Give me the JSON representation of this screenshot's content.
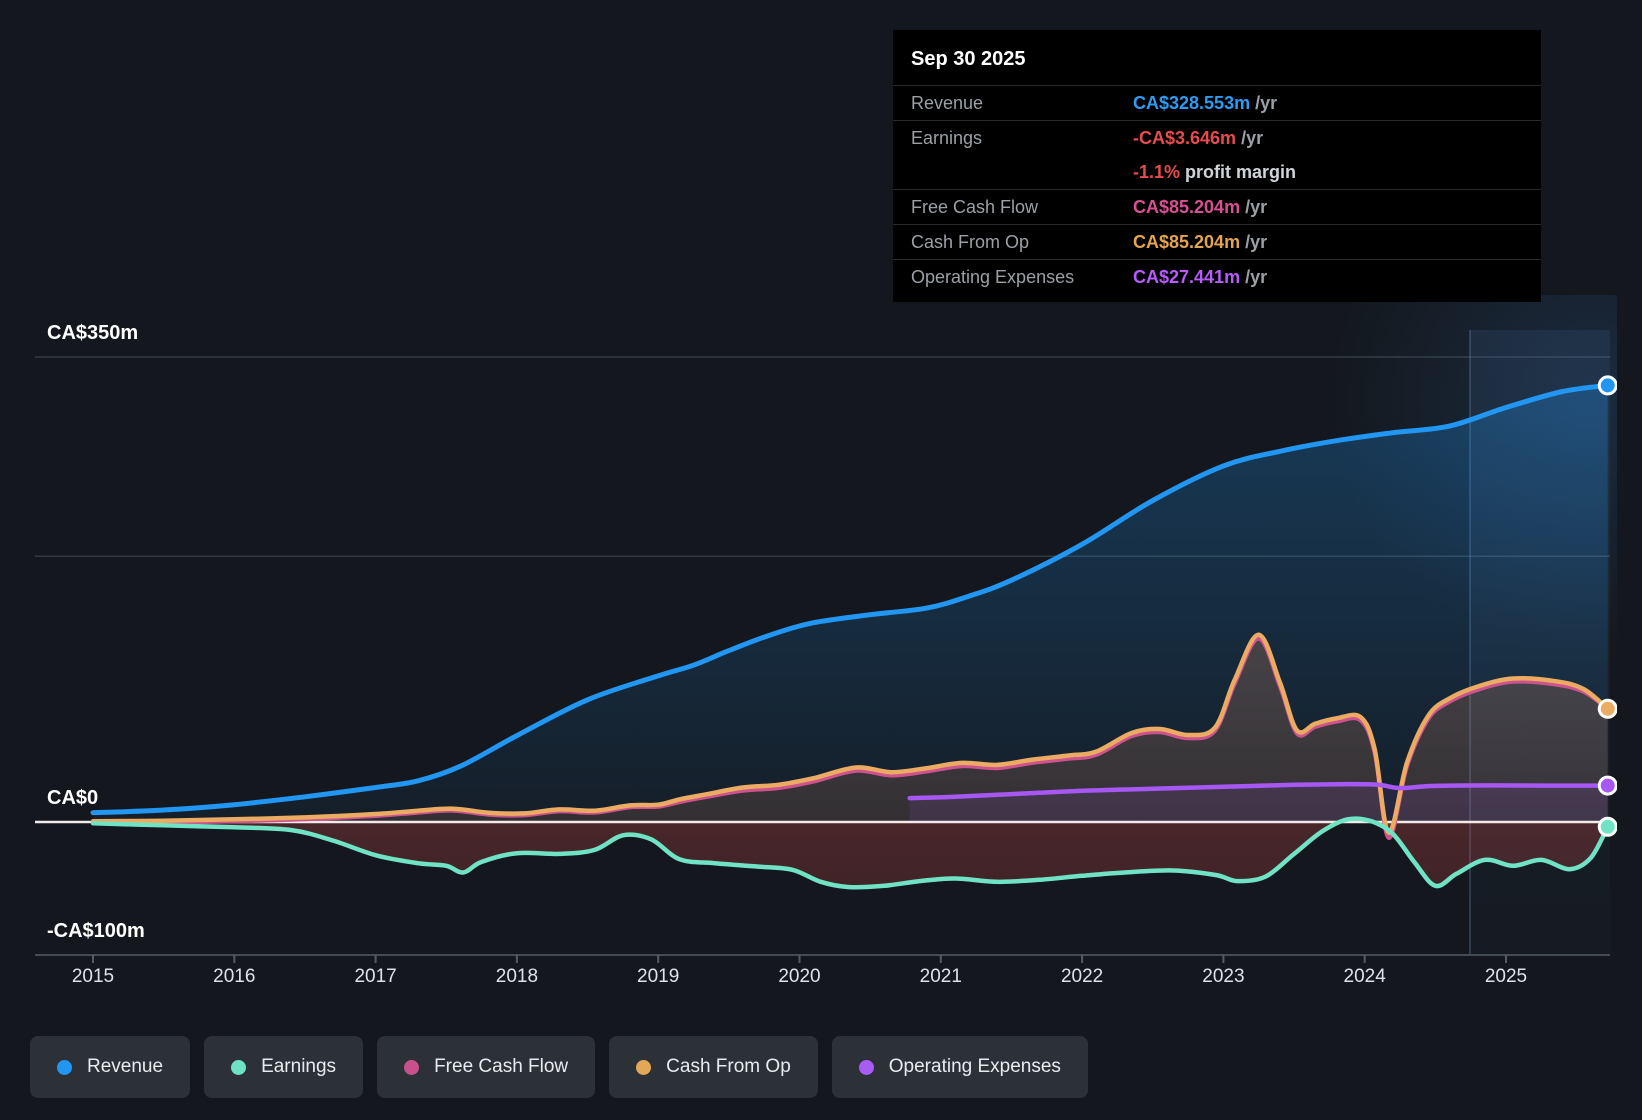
{
  "tooltip": {
    "title": "Sep 30 2025",
    "rows": [
      {
        "label": "Revenue",
        "value": "CA$328.553m",
        "suffix": " /yr",
        "value_color": "#2d9bf3"
      },
      {
        "label": "Earnings",
        "value": "-CA$3.646m",
        "suffix": " /yr",
        "value_color": "#e64c4f"
      },
      {
        "label": "",
        "value": "-1.1%",
        "suffix": " profit margin",
        "value_color": "#e64c4f"
      },
      {
        "label": "Free Cash Flow",
        "value": "CA$85.204m",
        "suffix": " /yr",
        "value_color": "#d94f93"
      },
      {
        "label": "Cash From Op",
        "value": "CA$85.204m",
        "suffix": " /yr",
        "value_color": "#e3a44f"
      },
      {
        "label": "Operating Expenses",
        "value": "CA$27.441m",
        "suffix": " /yr",
        "value_color": "#b75cfa"
      }
    ]
  },
  "legend": {
    "items": [
      {
        "label": "Revenue",
        "color": "#2196f3"
      },
      {
        "label": "Earnings",
        "color": "#6fe3c1"
      },
      {
        "label": "Free Cash Flow",
        "color": "#c9518b"
      },
      {
        "label": "Cash From Op",
        "color": "#e2a757"
      },
      {
        "label": "Operating Expenses",
        "color": "#a95bf5"
      }
    ]
  },
  "chart_data": {
    "type": "area",
    "title": "Financial history: revenue, earnings and cash flow (CA$m)",
    "y_ticks": [
      {
        "label": "CA$350m",
        "value": 350
      },
      {
        "label": "CA$0",
        "value": 0
      },
      {
        "label": "-CA$100m",
        "value": -100
      }
    ],
    "mid_gridline_value": 200,
    "x_ticks": [
      2015,
      2016,
      2017,
      2018,
      2019,
      2020,
      2021,
      2022,
      2023,
      2024,
      2025
    ],
    "xlim": [
      2014.59,
      2025.78
    ],
    "ylim": [
      -100,
      370
    ],
    "grid": true,
    "legend_position": "bottom",
    "highlight_band_start": 2024.745,
    "highlight_band_end": 2025.78,
    "series": [
      {
        "name": "Revenue",
        "color": "#2196f3",
        "width": 5,
        "fill_top": "rgba(33,150,243,0.30)",
        "fill_bottom": "rgba(33,150,243,0.05)",
        "end_marker": true,
        "points": [
          [
            2015,
            7
          ],
          [
            2015.5,
            9
          ],
          [
            2016,
            13
          ],
          [
            2016.5,
            19
          ],
          [
            2017,
            26
          ],
          [
            2017.3,
            31
          ],
          [
            2017.6,
            42
          ],
          [
            2018,
            65
          ],
          [
            2018.5,
            92
          ],
          [
            2019,
            110
          ],
          [
            2019.25,
            118
          ],
          [
            2019.5,
            129
          ],
          [
            2019.8,
            141
          ],
          [
            2020.1,
            150
          ],
          [
            2020.5,
            156
          ],
          [
            2020.9,
            161
          ],
          [
            2021.2,
            170
          ],
          [
            2021.5,
            182
          ],
          [
            2022,
            209
          ],
          [
            2022.5,
            242
          ],
          [
            2023,
            268
          ],
          [
            2023.4,
            279
          ],
          [
            2023.8,
            287
          ],
          [
            2024.2,
            293
          ],
          [
            2024.6,
            298
          ],
          [
            2025,
            312
          ],
          [
            2025.4,
            324
          ],
          [
            2025.72,
            328.6
          ]
        ]
      },
      {
        "name": "Free Cash Flow",
        "color": "#cc538d",
        "width": 4,
        "fill_top": "rgba(204,83,141,0.12)",
        "fill_bottom": "rgba(204,83,141,0.05)",
        "end_marker": false,
        "points": [
          [
            2015,
            -0.8
          ],
          [
            2015.5,
            -0.5
          ],
          [
            2016,
            0.5
          ],
          [
            2016.5,
            2
          ],
          [
            2017,
            4.5
          ],
          [
            2017.3,
            7
          ],
          [
            2017.55,
            8.5
          ],
          [
            2017.8,
            5.5
          ],
          [
            2018.05,
            5
          ],
          [
            2018.3,
            8
          ],
          [
            2018.55,
            7
          ],
          [
            2018.8,
            11
          ],
          [
            2019,
            11.5
          ],
          [
            2019.15,
            15
          ],
          [
            2019.35,
            19
          ],
          [
            2019.6,
            23.5
          ],
          [
            2019.85,
            25.5
          ],
          [
            2020.1,
            30.5
          ],
          [
            2020.4,
            38.5
          ],
          [
            2020.65,
            35
          ],
          [
            2020.9,
            38
          ],
          [
            2021.15,
            42
          ],
          [
            2021.4,
            40.5
          ],
          [
            2021.65,
            44.5
          ],
          [
            2021.9,
            47.5
          ],
          [
            2022.1,
            50.5
          ],
          [
            2022.35,
            64.5
          ],
          [
            2022.55,
            67.5
          ],
          [
            2022.75,
            63
          ],
          [
            2022.94,
            68.5
          ],
          [
            2023.08,
            104
          ],
          [
            2023.25,
            138
          ],
          [
            2023.4,
            102
          ],
          [
            2023.52,
            66.5
          ],
          [
            2023.65,
            71.5
          ],
          [
            2023.8,
            75.5
          ],
          [
            2023.97,
            76.5
          ],
          [
            2024.07,
            52
          ],
          [
            2024.17,
            -12
          ],
          [
            2024.3,
            42
          ],
          [
            2024.45,
            77.5
          ],
          [
            2024.6,
            90.5
          ],
          [
            2024.8,
            99.5
          ],
          [
            2025.05,
            105.5
          ],
          [
            2025.35,
            103.5
          ],
          [
            2025.55,
            98
          ],
          [
            2025.72,
            85.2
          ]
        ]
      },
      {
        "name": "Cash From Op",
        "color": "#ecab62",
        "width": 4.5,
        "fill_top": "rgba(232,168,92,0.30)",
        "fill_bottom": "rgba(232,168,92,0.10)",
        "end_marker": true,
        "points": [
          [
            2015,
            0.5
          ],
          [
            2015.5,
            1
          ],
          [
            2016,
            2
          ],
          [
            2016.5,
            3.5
          ],
          [
            2017,
            6
          ],
          [
            2017.3,
            8.5
          ],
          [
            2017.55,
            10
          ],
          [
            2017.8,
            7
          ],
          [
            2018.05,
            6.5
          ],
          [
            2018.3,
            9.5
          ],
          [
            2018.55,
            8.5
          ],
          [
            2018.8,
            12.5
          ],
          [
            2019,
            13
          ],
          [
            2019.15,
            17
          ],
          [
            2019.35,
            21
          ],
          [
            2019.6,
            26
          ],
          [
            2019.85,
            28
          ],
          [
            2020.1,
            33
          ],
          [
            2020.4,
            41
          ],
          [
            2020.65,
            37.5
          ],
          [
            2020.9,
            40.5
          ],
          [
            2021.15,
            44.5
          ],
          [
            2021.4,
            43
          ],
          [
            2021.65,
            47
          ],
          [
            2021.9,
            50
          ],
          [
            2022.1,
            53
          ],
          [
            2022.35,
            67
          ],
          [
            2022.55,
            70
          ],
          [
            2022.75,
            65.5
          ],
          [
            2022.94,
            71
          ],
          [
            2023.08,
            107
          ],
          [
            2023.25,
            141
          ],
          [
            2023.4,
            105
          ],
          [
            2023.52,
            69
          ],
          [
            2023.65,
            74
          ],
          [
            2023.8,
            78
          ],
          [
            2023.97,
            79
          ],
          [
            2024.07,
            55
          ],
          [
            2024.17,
            -8
          ],
          [
            2024.3,
            45
          ],
          [
            2024.45,
            80
          ],
          [
            2024.6,
            93
          ],
          [
            2024.8,
            102
          ],
          [
            2025.05,
            108
          ],
          [
            2025.35,
            106
          ],
          [
            2025.55,
            100
          ],
          [
            2025.72,
            85.2
          ]
        ]
      },
      {
        "name": "Operating Expenses",
        "color": "#a757f2",
        "width": 4.5,
        "fill_top": "rgba(167,87,242,0.32)",
        "fill_bottom": "rgba(167,87,242,0.10)",
        "end_marker": true,
        "points": [
          [
            2020.78,
            18
          ],
          [
            2021.1,
            19
          ],
          [
            2021.5,
            21
          ],
          [
            2022,
            23.5
          ],
          [
            2022.5,
            25
          ],
          [
            2023,
            26.5
          ],
          [
            2023.5,
            28
          ],
          [
            2023.9,
            28.5
          ],
          [
            2024.1,
            28
          ],
          [
            2024.25,
            25.5
          ],
          [
            2024.45,
            27
          ],
          [
            2024.7,
            27.5
          ],
          [
            2025.1,
            27.5
          ],
          [
            2025.4,
            27.4
          ],
          [
            2025.72,
            27.4
          ]
        ]
      },
      {
        "name": "Earnings",
        "color": "#6fe3c4",
        "width": 4.5,
        "fill_top": "rgba(226,78,78,0.26)",
        "fill_bottom": "rgba(226,78,78,0.16)",
        "fill_below_zero": true,
        "end_marker": true,
        "points": [
          [
            2015,
            -1
          ],
          [
            2015.5,
            -2.5
          ],
          [
            2016,
            -4
          ],
          [
            2016.4,
            -6
          ],
          [
            2016.7,
            -14
          ],
          [
            2017,
            -25
          ],
          [
            2017.3,
            -31
          ],
          [
            2017.5,
            -33
          ],
          [
            2017.62,
            -38
          ],
          [
            2017.75,
            -30
          ],
          [
            2018,
            -23.5
          ],
          [
            2018.3,
            -24
          ],
          [
            2018.55,
            -21
          ],
          [
            2018.75,
            -10
          ],
          [
            2018.95,
            -13
          ],
          [
            2019.15,
            -28
          ],
          [
            2019.4,
            -31
          ],
          [
            2019.7,
            -33.5
          ],
          [
            2019.95,
            -36
          ],
          [
            2020.15,
            -45
          ],
          [
            2020.35,
            -49
          ],
          [
            2020.6,
            -48
          ],
          [
            2020.85,
            -44.5
          ],
          [
            2021.1,
            -42.5
          ],
          [
            2021.4,
            -45
          ],
          [
            2021.7,
            -43.5
          ],
          [
            2022,
            -40.5
          ],
          [
            2022.3,
            -38
          ],
          [
            2022.65,
            -36.5
          ],
          [
            2022.95,
            -40
          ],
          [
            2023.1,
            -44.5
          ],
          [
            2023.3,
            -41
          ],
          [
            2023.5,
            -24
          ],
          [
            2023.7,
            -7
          ],
          [
            2023.88,
            2
          ],
          [
            2024.05,
            0.5
          ],
          [
            2024.2,
            -9
          ],
          [
            2024.35,
            -30
          ],
          [
            2024.5,
            -48
          ],
          [
            2024.65,
            -39
          ],
          [
            2024.85,
            -28.5
          ],
          [
            2025.05,
            -33
          ],
          [
            2025.25,
            -28.5
          ],
          [
            2025.45,
            -35.5
          ],
          [
            2025.6,
            -27
          ],
          [
            2025.72,
            -3.6
          ]
        ]
      }
    ]
  }
}
